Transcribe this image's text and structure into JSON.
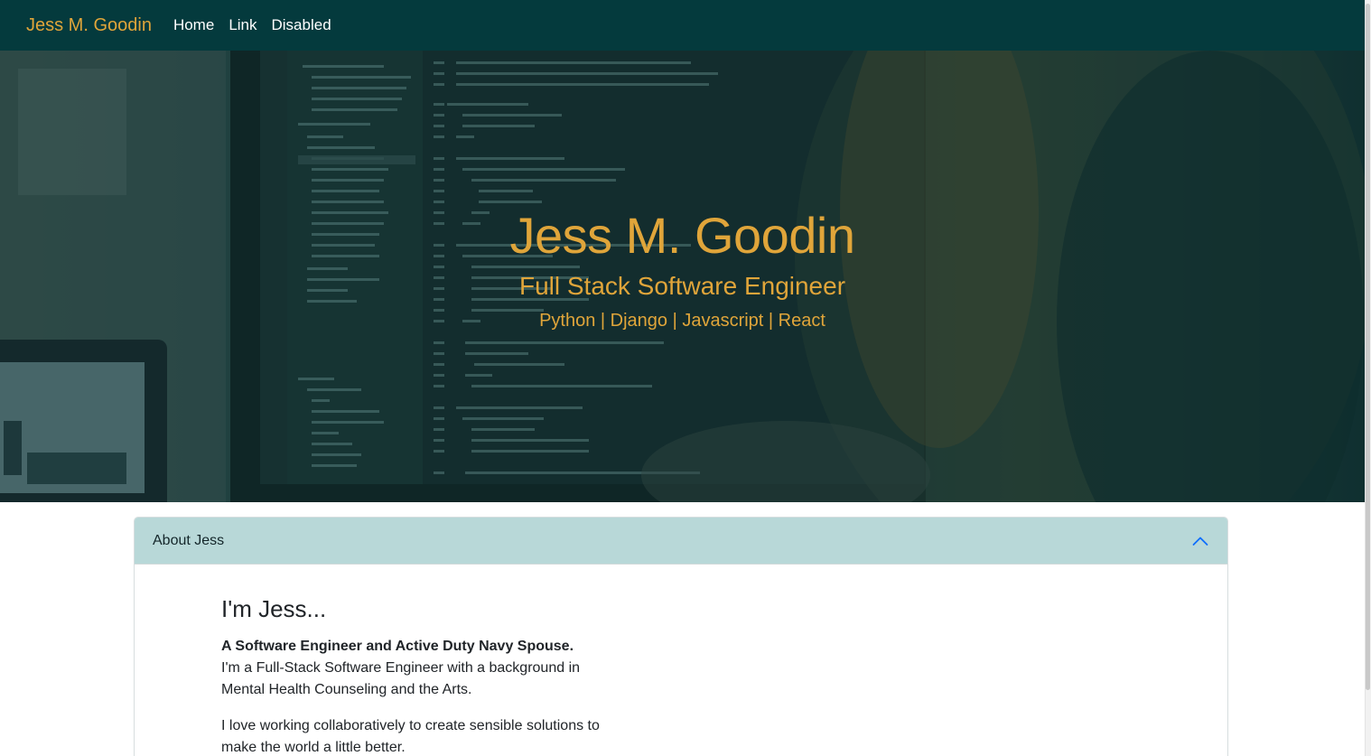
{
  "navbar": {
    "brand": "Jess M. Goodin",
    "links": [
      {
        "label": "Home"
      },
      {
        "label": "Link"
      },
      {
        "label": "Disabled"
      }
    ]
  },
  "hero": {
    "title": "Jess M. Goodin",
    "subtitle": "Full Stack Software Engineer",
    "skills": "Python | Django | Javascript | React"
  },
  "about": {
    "header": "About Jess",
    "heading": "I'm Jess...",
    "lead": "A Software Engineer and Active Duty Navy Spouse.",
    "paragraph1": "I'm a Full-Stack Software Engineer with a background in Mental Health Counseling and the Arts.",
    "paragraph2": "I love working collaboratively to create sensible solutions to make the world a little better."
  },
  "colors": {
    "navbar_bg": "#043a3d",
    "accent_gold": "#e0a53a",
    "accordion_header_bg": "#b8d8d8",
    "chevron_blue": "#0d6efd"
  },
  "icons": {
    "accordion_toggle": "chevron-up-icon"
  }
}
